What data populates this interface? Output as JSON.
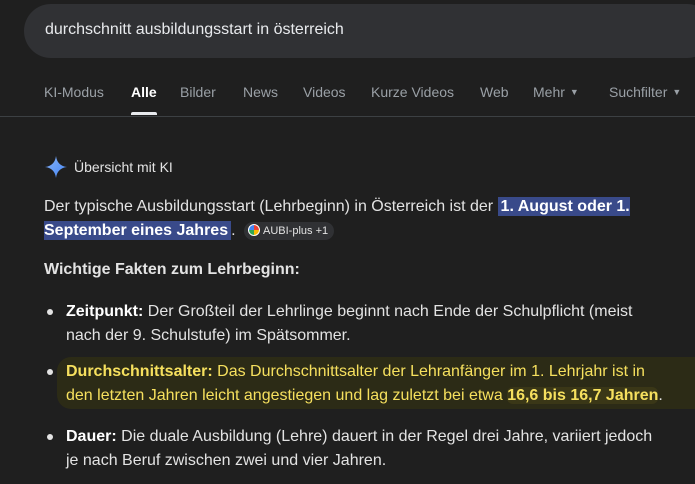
{
  "search": {
    "query": "durchschnitt ausbildungsstart in österreich"
  },
  "tabs": {
    "ki_modus": "KI-Modus",
    "alle": "Alle",
    "bilder": "Bilder",
    "news": "News",
    "videos": "Videos",
    "kurze_videos": "Kurze Videos",
    "web": "Web",
    "mehr": "Mehr",
    "suchfilter": "Suchfilter"
  },
  "overview": {
    "title": "Übersicht mit KI",
    "intro_before": "Der typische Ausbildungsstart (Lehrbeginn) in Österreich ist der ",
    "intro_highlight": "1. August oder 1. September eines Jahres",
    "intro_after": ".",
    "source_chip": "AUBI-plus +1",
    "facts_heading": "Wichtige Fakten zum Lehrbeginn:",
    "bullets": [
      {
        "label": "Zeitpunkt:",
        "text": " Der Großteil der Lehrlinge beginnt nach Ende der Schulpflicht (meist nach der 9. Schulstufe) im Spätsommer."
      },
      {
        "label": "Durchschnittsalter:",
        "text": " Das Durchschnittsalter der Lehranfänger im 1. Lehrjahr ist in den letzten Jahren leicht angestiegen und lag zuletzt bei etwa ",
        "strong": "16,6 bis 16,7 Jahren",
        "end": "."
      },
      {
        "label": "Dauer:",
        "text": " Die duale Ausbildung (Lehre) dauert in der Regel drei Jahre, variiert jedoch je nach Beruf zwischen zwei und vier Jahren."
      }
    ]
  },
  "colors": {
    "background": "#1f1f1f",
    "highlight_blue": "#394a8a",
    "highlight_yellow_text": "#f6e05e"
  }
}
